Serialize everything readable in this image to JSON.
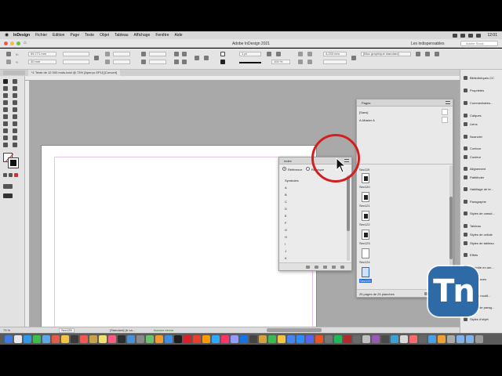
{
  "menubar": {
    "app": "InDesign",
    "items": [
      "Fichier",
      "Edition",
      "Page",
      "Texte",
      "Objet",
      "Tableau",
      "Affichage",
      "Fenêtre",
      "Aide"
    ],
    "clock": "12:01"
  },
  "window": {
    "title": "Adobe InDesign 2021",
    "workspace": "Les indispensables",
    "search_placeholder": "Adobe Stock"
  },
  "controlbar": {
    "x_value": "59,771 mm",
    "y_value": "30 mm",
    "stroke_weight": "1 pt",
    "zoom_percent": "100 %",
    "size_value": "4,233 mm",
    "frame_style": "[Bloc graphique standard]"
  },
  "document_tab": {
    "label": "*1 Texte de 12 000 mots.indd @ 73% [Aperçu GPU] [Convert]"
  },
  "pages_panel": {
    "tab": "Pages",
    "items": [
      "[Sans]",
      "A-Master A"
    ],
    "thumbs": [
      {
        "label": "Sec119",
        "dark": false
      },
      {
        "label": "Sec120",
        "dark": true
      },
      {
        "label": "Sec121",
        "dark": true
      },
      {
        "label": "Sec122",
        "dark": true
      },
      {
        "label": "Sec123",
        "dark": true
      },
      {
        "label": "Sec124",
        "dark": false
      },
      {
        "label": "Sec125",
        "dark": false,
        "selected": true
      }
    ],
    "footer": "25 pages de 25 planches"
  },
  "index_panel": {
    "tab": "Index",
    "mode_reference": "Référence",
    "mode_topic": "Rubrique",
    "entries": [
      "Symboles",
      "A",
      "B",
      "C",
      "D",
      "E",
      "F",
      "G",
      "H",
      "I",
      "J",
      "K",
      "L"
    ]
  },
  "right_dock": {
    "items": [
      {
        "label": "Bibliothèques CC",
        "icon": "cc-libraries-icon"
      },
      {
        "label": "Propriétés",
        "icon": "properties-icon"
      },
      {
        "label": "Commentaires...",
        "icon": "comments-icon"
      },
      {
        "label": "Calques",
        "icon": "layers-icon"
      },
      {
        "label": "Liens",
        "icon": "links-icon"
      },
      {
        "label": "Nuancier",
        "icon": "swatches-icon"
      },
      {
        "label": "Contour",
        "icon": "stroke-icon"
      },
      {
        "label": "Couleur",
        "icon": "color-icon"
      },
      {
        "label": "Alignement",
        "icon": "align-icon"
      },
      {
        "label": "Pathfinder",
        "icon": "pathfinder-icon"
      },
      {
        "label": "Habillage de te...",
        "icon": "text-wrap-icon"
      },
      {
        "label": "Paragraphe",
        "icon": "paragraph-icon"
      },
      {
        "label": "Styles de caract...",
        "icon": "char-styles-icon"
      },
      {
        "label": "Tableau",
        "icon": "table-icon"
      },
      {
        "label": "Styles de cellule",
        "icon": "cell-styles-icon"
      },
      {
        "label": "Styles de tableau",
        "icon": "table-styles-icon"
      },
      {
        "label": "Effets",
        "icon": "effects-icon"
      },
      {
        "label": "Contrôle en am...",
        "icon": "preflight-icon"
      },
      {
        "label": "Ressources",
        "icon": "resources-icon"
      },
      {
        "label": "Scripts modif...",
        "icon": "scripts-icon"
      },
      {
        "label": "Styles de parag...",
        "icon": "para-styles-icon"
      },
      {
        "label": "Styles d'objet",
        "icon": "object-styles-icon"
      }
    ]
  },
  "statusbar": {
    "page": "Sec125",
    "style": "[Standard] (tr ca...",
    "status": "Aucune erreur"
  },
  "watermark": {
    "text": "Tn"
  },
  "colors": {
    "accent": "#2a6cd1",
    "cursor_ring": "#d21f1f",
    "logo_bg": "#2e6aa6"
  }
}
